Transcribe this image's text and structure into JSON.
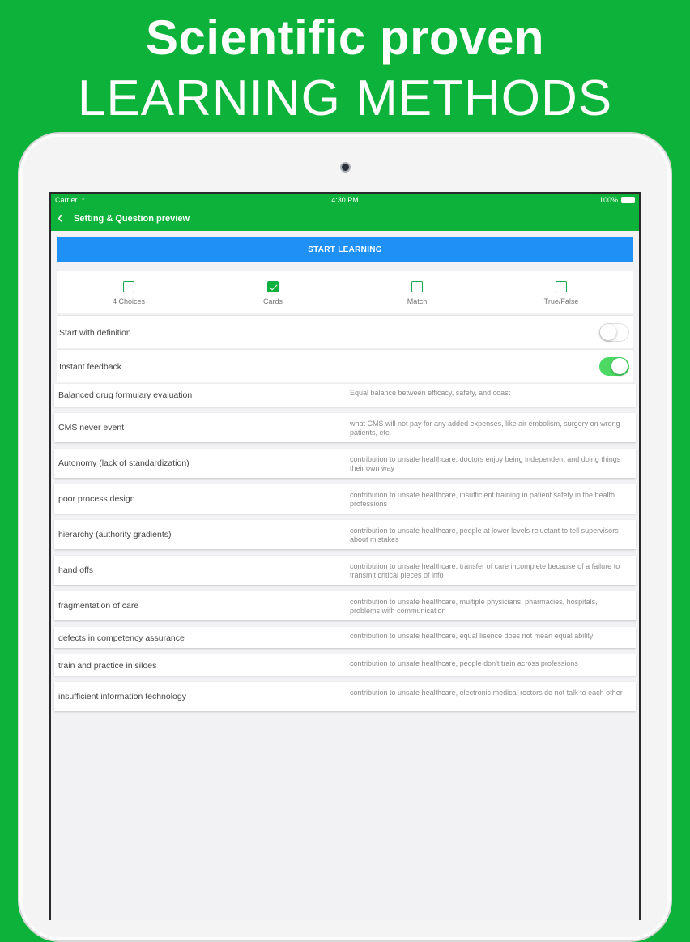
{
  "promo": {
    "line1": "Scientific proven",
    "line2": "LEARNING METHODS"
  },
  "status_bar": {
    "carrier": "Carrier",
    "time": "4:30 PM",
    "battery": "100%"
  },
  "nav": {
    "title": "Setting & Question preview"
  },
  "start_button": "START LEARNING",
  "modes": [
    {
      "label": "4 Choices",
      "checked": false
    },
    {
      "label": "Cards",
      "checked": true
    },
    {
      "label": "Match",
      "checked": false
    },
    {
      "label": "True/False",
      "checked": false
    }
  ],
  "settings": [
    {
      "label": "Start with definition",
      "on": false
    },
    {
      "label": "Instant feedback",
      "on": true
    }
  ],
  "cards": [
    {
      "term": "Balanced drug formulary evaluation",
      "definition": "Equal balance between efficacy, safety, and coast"
    },
    {
      "term": "CMS never event",
      "definition": "what CMS will not pay for any added expenses, like air embolism, surgery on wrong patients, etc."
    },
    {
      "term": "Autonomy (lack of standardization)",
      "definition": "contribution to unsafe healthcare, doctors enjoy being independent and doing things their own way"
    },
    {
      "term": "poor process design",
      "definition": "contribution to unsafe healthcare, insufficient training in patient safety in the health professions"
    },
    {
      "term": "hierarchy (authority gradients)",
      "definition": "contribution to unsafe healthcare, people at lower levels reluctant to tell supervisors about mistakes"
    },
    {
      "term": "hand offs",
      "definition": "contribution to unsafe healthcare, transfer of care incomplete because of a failure to transmit critical pieces of info"
    },
    {
      "term": "fragmentation of care",
      "definition": "contribution to unsafe healthcare, multiple physicians, pharmacies, hospitals, problems with communication"
    },
    {
      "term": "defects in competency assurance",
      "definition": "contribution to unsafe healthcare, equal lisence does not mean equal ability"
    },
    {
      "term": "train and practice in siloes",
      "definition": "contribution to unsafe healthcare, people don't train across professions"
    },
    {
      "term": "insufficient information technology",
      "definition": "contribution to unsafe healthcare, electronic medical rectors do not talk to each other"
    }
  ],
  "colors": {
    "brand_green": "#0db23a",
    "button_blue": "#1e90f6",
    "toggle_on": "#4cd964"
  }
}
